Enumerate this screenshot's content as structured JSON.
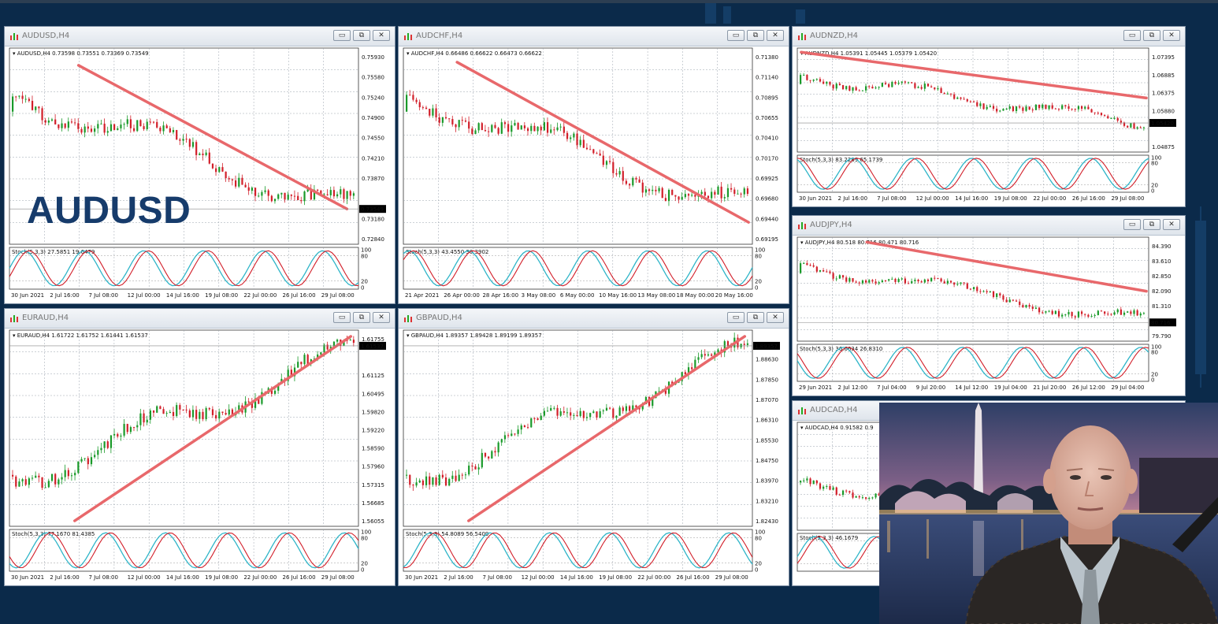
{
  "overlay_title": "AUDUSD",
  "windows": [
    {
      "id": "audusd",
      "title": "AUDUSD,H4",
      "info": "AUDUSD,H4  0.73598 0.73551 0.73369 0.73549",
      "price_labels": [
        "0.75930",
        "0.75580",
        "0.75240",
        "0.74900",
        "0.74550",
        "0.74210",
        "0.73870",
        "0.73549",
        "0.73180",
        "0.72840"
      ],
      "current_price": "0.73549",
      "stoch_info": "Stoch(5,3,3) 27.5851 19.6479",
      "stoch_levels": [
        "100",
        "80",
        "20",
        "0"
      ],
      "date_labels": [
        "30 Jun 2021",
        "2 Jul 16:00",
        "7 Jul 08:00",
        "12 Jul 00:00",
        "14 Jul 16:00",
        "19 Jul 08:00",
        "22 Jul 00:00",
        "26 Jul 16:00",
        "29 Jul 08:00"
      ]
    },
    {
      "id": "audchf",
      "title": "AUDCHF,H4",
      "info": "AUDCHF,H4  0.66486 0.66622 0.66473 0.66622",
      "price_labels": [
        "0.71380",
        "0.71140",
        "0.70895",
        "0.70655",
        "0.70410",
        "0.70170",
        "0.69925",
        "0.69680",
        "0.69440",
        "0.69195"
      ],
      "current_price": "",
      "stoch_info": "Stoch(5,3,3) 43.4550 30.3902",
      "stoch_levels": [
        "100",
        "80",
        "20",
        "0"
      ],
      "date_labels": [
        "21 Apr 2021",
        "26 Apr 00:00",
        "28 Apr 16:00",
        "3 May 08:00",
        "6 May 00:00",
        "10 May 16:00",
        "13 May 08:00",
        "18 May 00:00",
        "20 May 16:00"
      ]
    },
    {
      "id": "audnzd",
      "title": "AUDNZD,H4",
      "info": "AUDNZD,H4  1.05391 1.05445 1.05379 1.05420",
      "price_labels": [
        "1.07395",
        "1.06885",
        "1.06375",
        "1.05880",
        "1.05420",
        "1.04875"
      ],
      "current_price": "1.05420",
      "stoch_info": "Stoch(5,3,3) 83.2289 65.1739",
      "stoch_levels": [
        "100",
        "80",
        "20",
        "0"
      ],
      "date_labels": [
        "30 Jun 2021",
        "2 Jul 16:00",
        "7 Jul 08:00",
        "12 Jul 00:00",
        "14 Jul 16:00",
        "19 Jul 08:00",
        "22 Jul 00:00",
        "26 Jul 16:00",
        "29 Jul 08:00"
      ]
    },
    {
      "id": "audjpy",
      "title": "AUDJPY,H4",
      "info": "AUDJPY,H4  80.518 80.716 80.471 80.716",
      "price_labels": [
        "84.390",
        "83.610",
        "82.850",
        "82.090",
        "81.310",
        "80.716",
        "79.790"
      ],
      "current_price": "80.716",
      "stoch_info": "Stoch(5,3,3) 36.6634 26.8310",
      "stoch_levels": [
        "100",
        "80",
        "20",
        "0"
      ],
      "date_labels": [
        "29 Jun 2021",
        "2 Jul 12:00",
        "7 Jul 04:00",
        "9 Jul 20:00",
        "14 Jul 12:00",
        "19 Jul 04:00",
        "21 Jul 20:00",
        "26 Jul 12:00",
        "29 Jul 04:00"
      ]
    },
    {
      "id": "euraud",
      "title": "EURAUD,H4",
      "info": "EURAUD,H4  1.61722 1.61752 1.61441 1.61537",
      "price_labels": [
        "1.61755",
        "1.61537",
        "1.61125",
        "1.60495",
        "1.59820",
        "1.59220",
        "1.58590",
        "1.57960",
        "1.57315",
        "1.56685",
        "1.56055"
      ],
      "current_price": "1.61537",
      "stoch_info": "Stoch(5,3,3) 77.1670 81.4385",
      "stoch_levels": [
        "100",
        "80",
        "20",
        "0"
      ],
      "date_labels": [
        "30 Jun 2021",
        "2 Jul 16:00",
        "7 Jul 08:00",
        "12 Jul 00:00",
        "14 Jul 16:00",
        "19 Jul 08:00",
        "22 Jul 00:00",
        "26 Jul 16:00",
        "29 Jul 08:00"
      ]
    },
    {
      "id": "gbpaud",
      "title": "GBPAUD,H4",
      "info": "GBPAUD,H4  1.89357 1.89428 1.89199 1.89357",
      "price_labels": [
        "1.89357",
        "1.88630",
        "1.87850",
        "1.87070",
        "1.86310",
        "1.85530",
        "1.84750",
        "1.83970",
        "1.83210",
        "1.82430"
      ],
      "current_price": "1.89357",
      "stoch_info": "Stoch(5,3,3) 54.8089 56.5409",
      "stoch_levels": [
        "100",
        "80",
        "20",
        "0"
      ],
      "date_labels": [
        "30 Jun 2021",
        "2 Jul 16:00",
        "7 Jul 08:00",
        "12 Jul 00:00",
        "14 Jul 16:00",
        "19 Jul 08:00",
        "22 Jul 00:00",
        "26 Jul 16:00",
        "29 Jul 08:00"
      ]
    },
    {
      "id": "audcad",
      "title": "AUDCAD,H4",
      "info": "AUDCAD,H4  0.91582 0.9",
      "price_labels": [],
      "current_price": "",
      "stoch_info": "Stoch(5,3,3) 46.1679",
      "stoch_levels": [],
      "date_labels": []
    }
  ],
  "window_buttons": {
    "minimize": "▭",
    "restore": "⧉",
    "close": "✕"
  },
  "colors": {
    "background": "#0b2a4a",
    "bull_candle": "#1a9a2a",
    "bear_candle": "#d21f2a",
    "trendline": "#e8686b",
    "stoch_main": "#2fb5c8",
    "stoch_signal": "#d21f2a",
    "overlay_title": "#163b6b"
  },
  "webcam": {
    "label": "presenter webcam feed"
  }
}
